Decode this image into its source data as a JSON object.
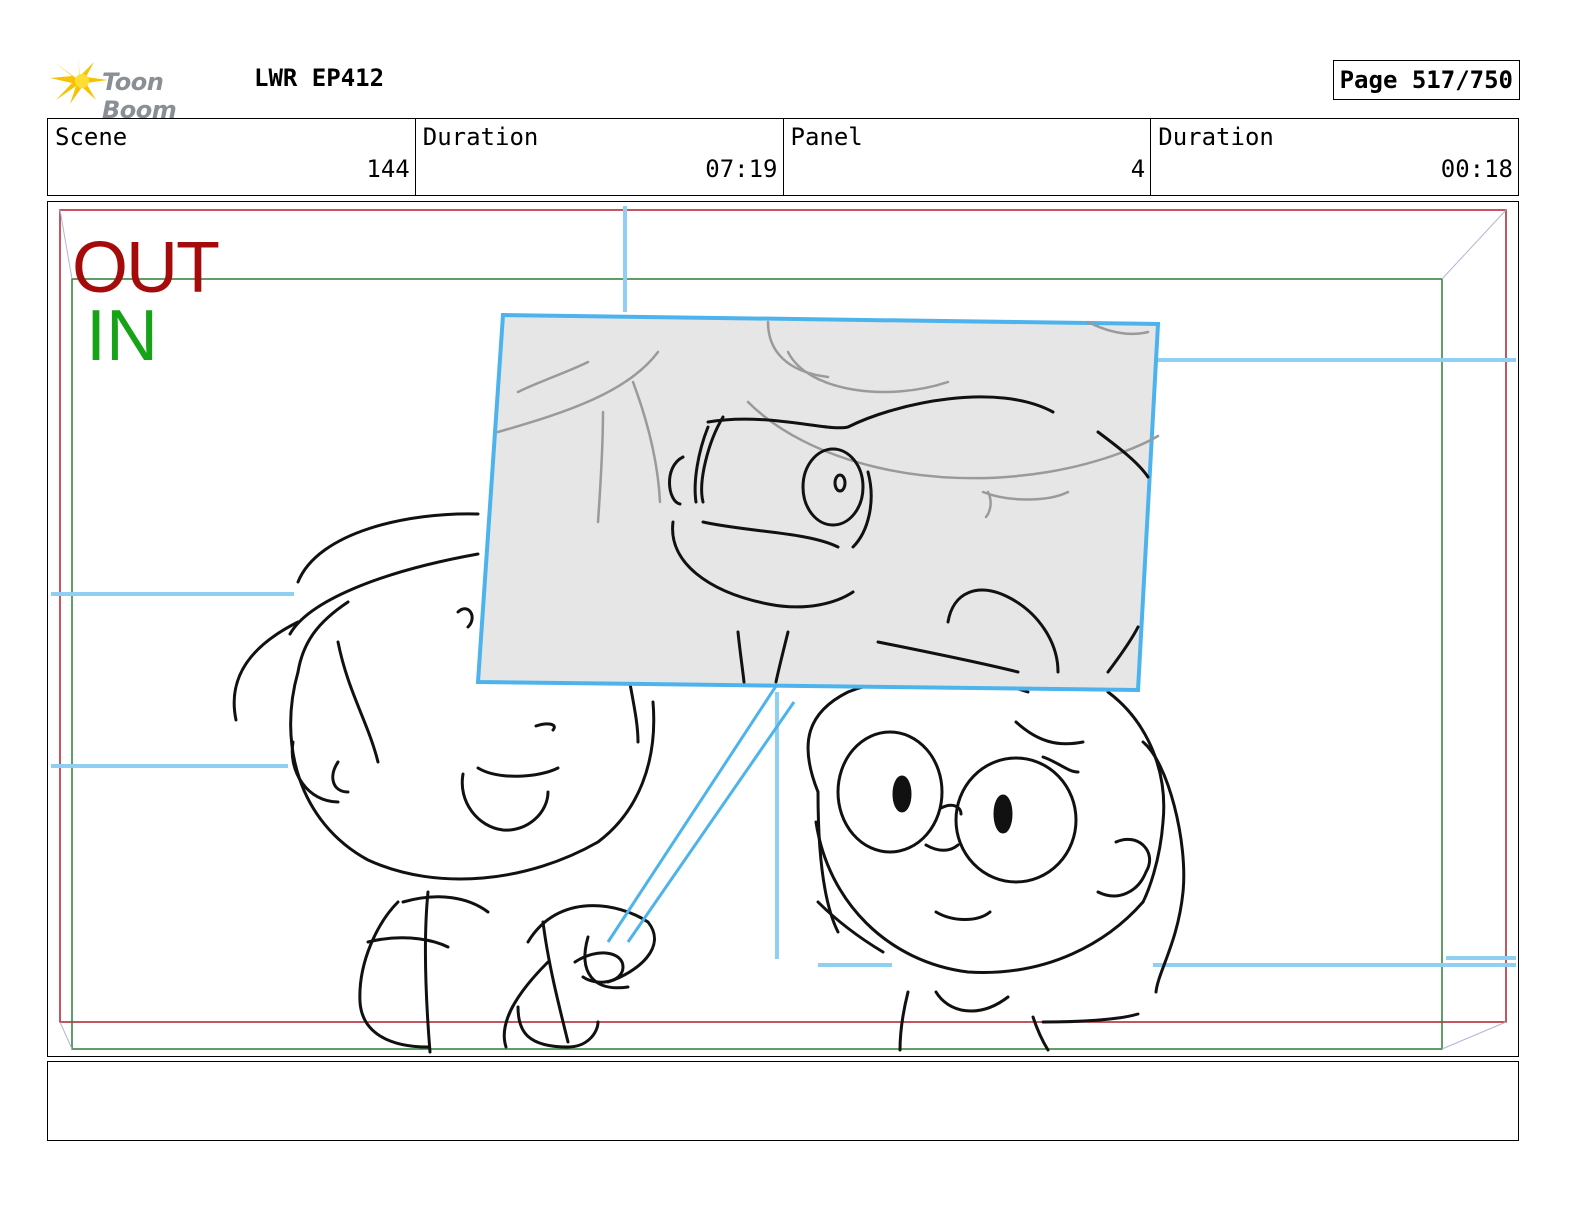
{
  "header": {
    "logo_text": "Toon Boom",
    "project": "LWR EP412",
    "page": "Page 517/750"
  },
  "info": {
    "scene_label": "Scene",
    "scene_value": "144",
    "scene_duration_label": "Duration",
    "scene_duration_value": "07:19",
    "panel_label": "Panel",
    "panel_value": "4",
    "panel_duration_label": "Duration",
    "panel_duration_value": "00:18"
  },
  "panel": {
    "out_label": "OUT",
    "in_label": "IN",
    "colors": {
      "out_frame": "#b01e2a",
      "in_frame": "#2e7d32",
      "guide": "#4db3ec",
      "sketch": "#111111"
    }
  },
  "notes": {
    "text": ""
  }
}
